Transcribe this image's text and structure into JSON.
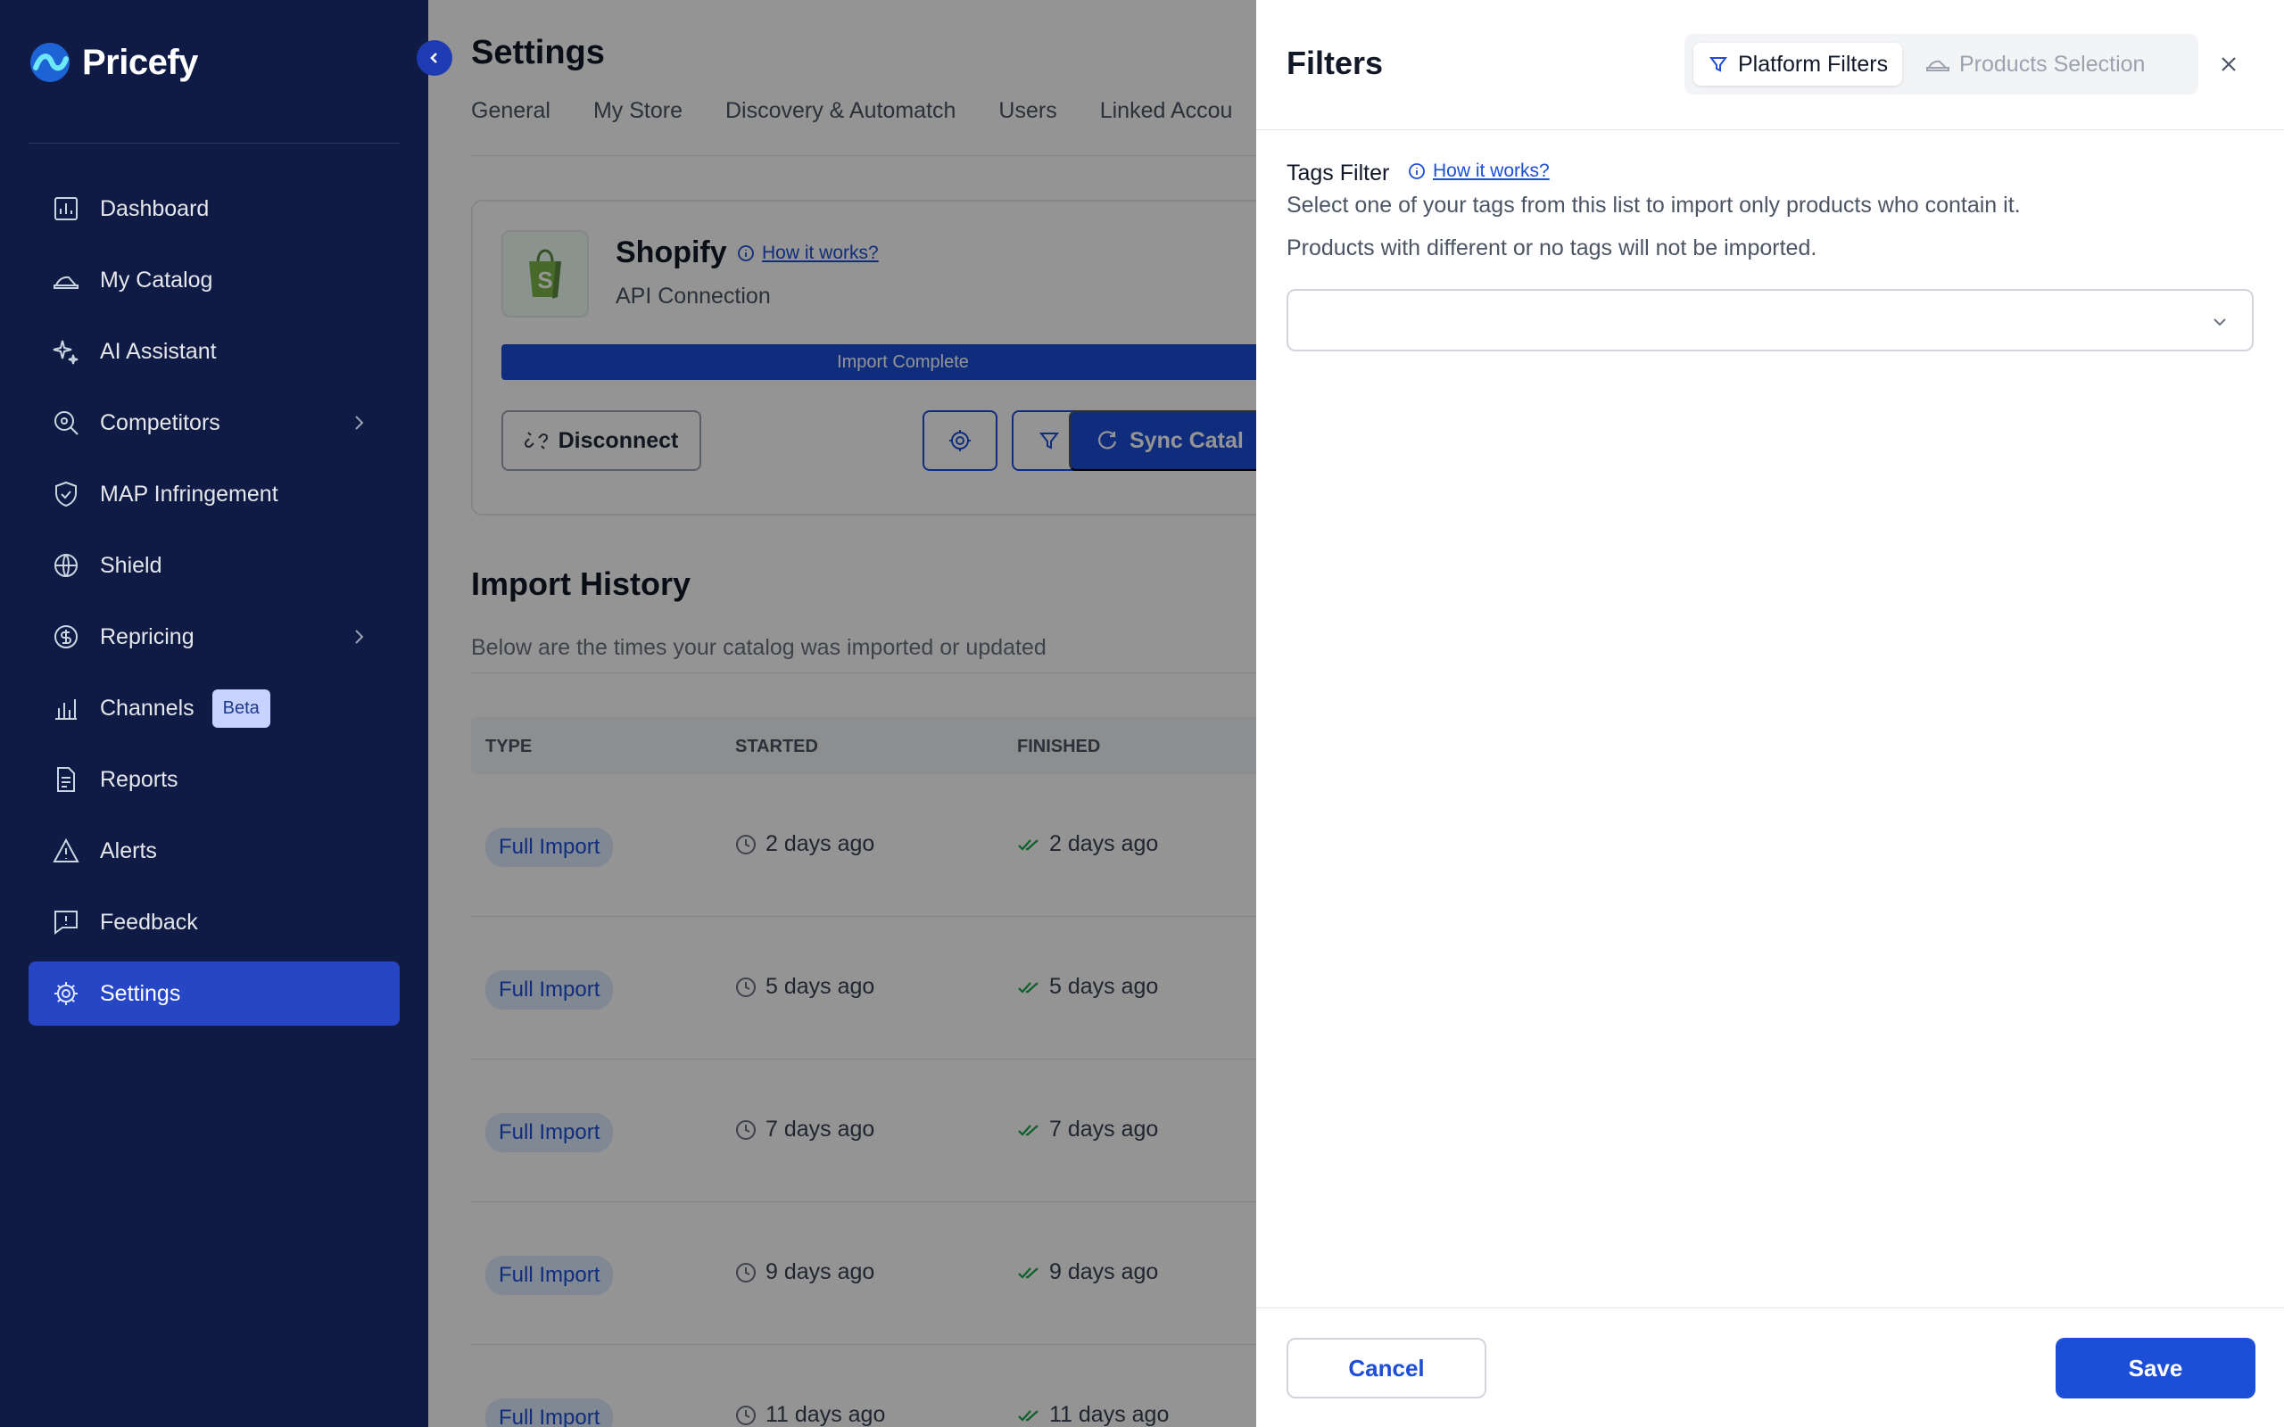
{
  "app": {
    "name": "Pricefy"
  },
  "sidebar": {
    "items": [
      {
        "label": "Dashboard",
        "icon": "chart-icon"
      },
      {
        "label": "My Catalog",
        "icon": "catalog-icon"
      },
      {
        "label": "AI Assistant",
        "icon": "sparkle-icon"
      },
      {
        "label": "Competitors",
        "icon": "search-icon",
        "expandable": true
      },
      {
        "label": "MAP Infringement",
        "icon": "shield-check-icon"
      },
      {
        "label": "Shield",
        "icon": "globe-icon"
      },
      {
        "label": "Repricing",
        "icon": "dollar-icon",
        "expandable": true
      },
      {
        "label": "Channels",
        "icon": "channels-icon",
        "badge": "Beta"
      },
      {
        "label": "Reports",
        "icon": "document-icon"
      },
      {
        "label": "Alerts",
        "icon": "warning-icon"
      },
      {
        "label": "Feedback",
        "icon": "feedback-icon"
      },
      {
        "label": "Settings",
        "icon": "gear-icon",
        "active": true
      }
    ]
  },
  "main": {
    "title": "Settings",
    "tabs": [
      "General",
      "My Store",
      "Discovery & Automatch",
      "Users",
      "Linked Accou"
    ],
    "connection": {
      "name": "Shopify",
      "how_link": "How it works?",
      "subtitle": "API Connection",
      "progress_label": "Import Complete",
      "progress": 1.0,
      "disconnect_label": "Disconnect",
      "sync_label": "Sync Catal"
    },
    "history": {
      "title": "Import History",
      "subtitle": "Below are the times your catalog was imported or updated",
      "columns": [
        "TYPE",
        "STARTED",
        "FINISHED"
      ],
      "rows": [
        {
          "type": "Full Import",
          "started": "2 days ago",
          "finished": "2 days ago"
        },
        {
          "type": "Full Import",
          "started": "5 days ago",
          "finished": "5 days ago"
        },
        {
          "type": "Full Import",
          "started": "7 days ago",
          "finished": "7 days ago"
        },
        {
          "type": "Full Import",
          "started": "9 days ago",
          "finished": "9 days ago"
        },
        {
          "type": "Full Import",
          "started": "11 days ago",
          "finished": "11 days ago"
        }
      ]
    }
  },
  "drawer": {
    "title": "Filters",
    "tabs": {
      "platform": "Platform Filters",
      "products": "Products Selection"
    },
    "tags_filter": {
      "label": "Tags Filter",
      "how_link": "How it works?",
      "desc1": "Select one of your tags from this list to import only products who contain it.",
      "desc2": "Products with different or no tags will not be imported.",
      "value": ""
    },
    "cancel_label": "Cancel",
    "save_label": "Save"
  },
  "colors": {
    "sidebar_bg": "#0f1b45",
    "accent": "#1d4ed8",
    "active_nav": "#2746c6",
    "success": "#16a34a"
  }
}
